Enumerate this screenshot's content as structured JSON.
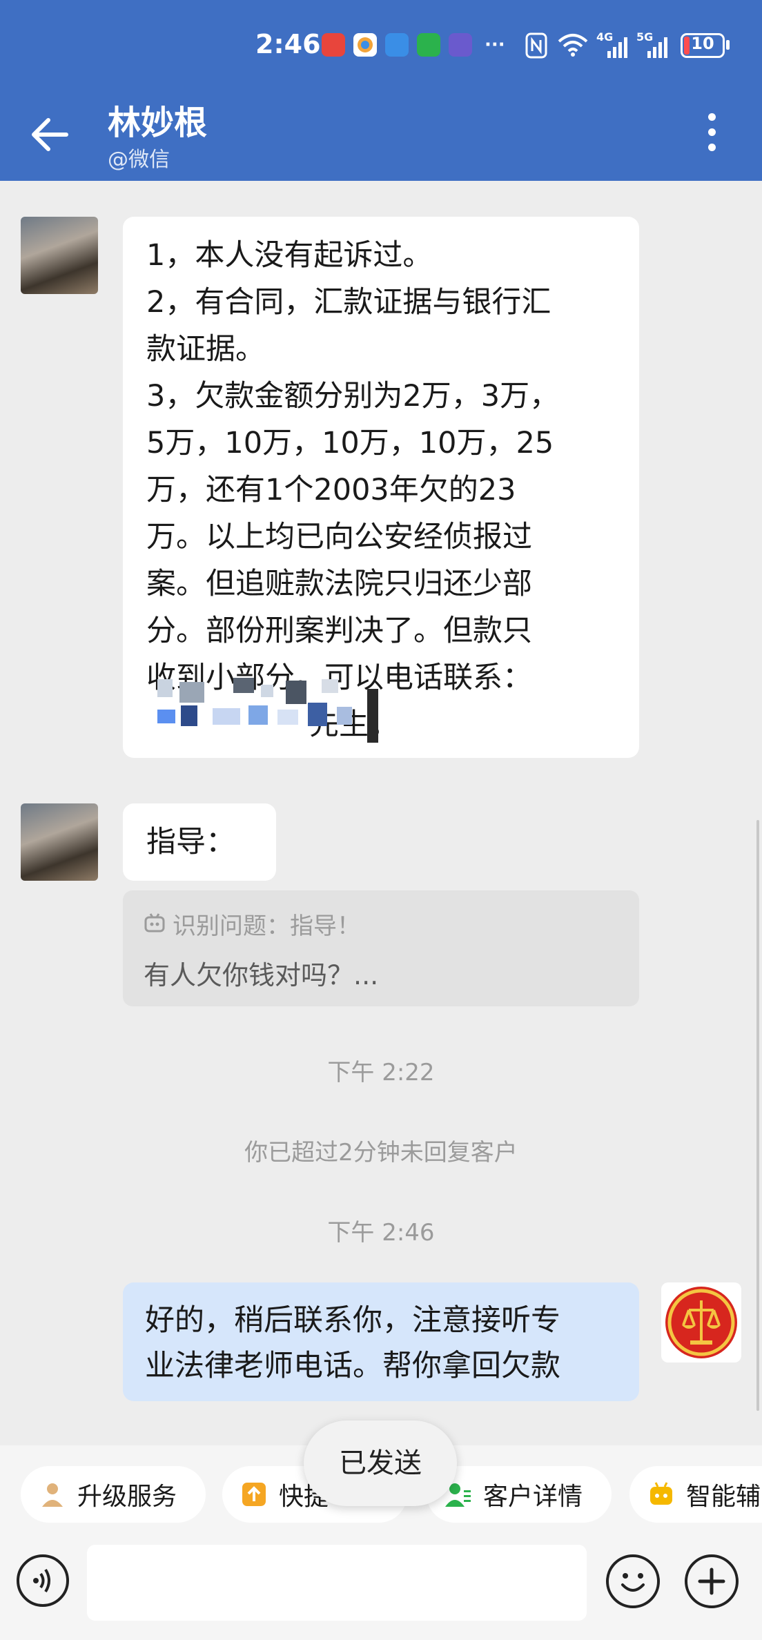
{
  "status_bar": {
    "time": "2:46",
    "more": "···",
    "net1": "4G",
    "net2": "5G",
    "battery": "10",
    "app_icons": [
      "red-app-icon",
      "colorful-app-icon",
      "blue-chat-app-icon",
      "wechat-icon",
      "purple-app-icon"
    ],
    "colors": [
      "#e8453c",
      "#f2a43a",
      "#3a8ee6",
      "#2bb24c",
      "#6a5acd"
    ]
  },
  "header": {
    "contact_name": "林妙根",
    "contact_source": "@微信"
  },
  "chat": {
    "msg1_lines": [
      "1，本人没有起诉过。",
      "2，有合同，汇款证据与银行汇",
      "款证据。",
      "3，欠款金额分别为2万，3万，",
      "5万，10万，10万，10万，25",
      "万，还有1个2003年欠的23",
      "万。以上均已向公安经侦报过",
      "案。但追赃款法院只归还少部",
      "分。部份刑案判决了。但款只",
      "收到小部分。可以电话联系：",
      "先生。"
    ],
    "msg2": "指导：",
    "quote_title": "识别问题：指导！",
    "quote_body": "有人欠你钱对吗？...",
    "time1": "下午 2:22",
    "system_notice": "你已超过2分钟未回复客户",
    "time2": "下午 2:46",
    "my_msg_line1": "好的，稍后联系你，注意接听专",
    "my_msg_line2": "业法律老师电话。帮你拿回欠款"
  },
  "quick_actions": [
    {
      "label": "升级服务",
      "icon": "person-crown-icon"
    },
    {
      "label": "快捷",
      "icon": "upload-icon"
    },
    {
      "label": "客户详情",
      "icon": "customer-detail-icon"
    },
    {
      "label": "智能辅",
      "icon": "robot-icon"
    }
  ],
  "toast": "已发送",
  "colors": {
    "header_bg": "#3f6fc3",
    "chat_bg": "#ededed",
    "my_bubble": "#d6e6fb"
  }
}
